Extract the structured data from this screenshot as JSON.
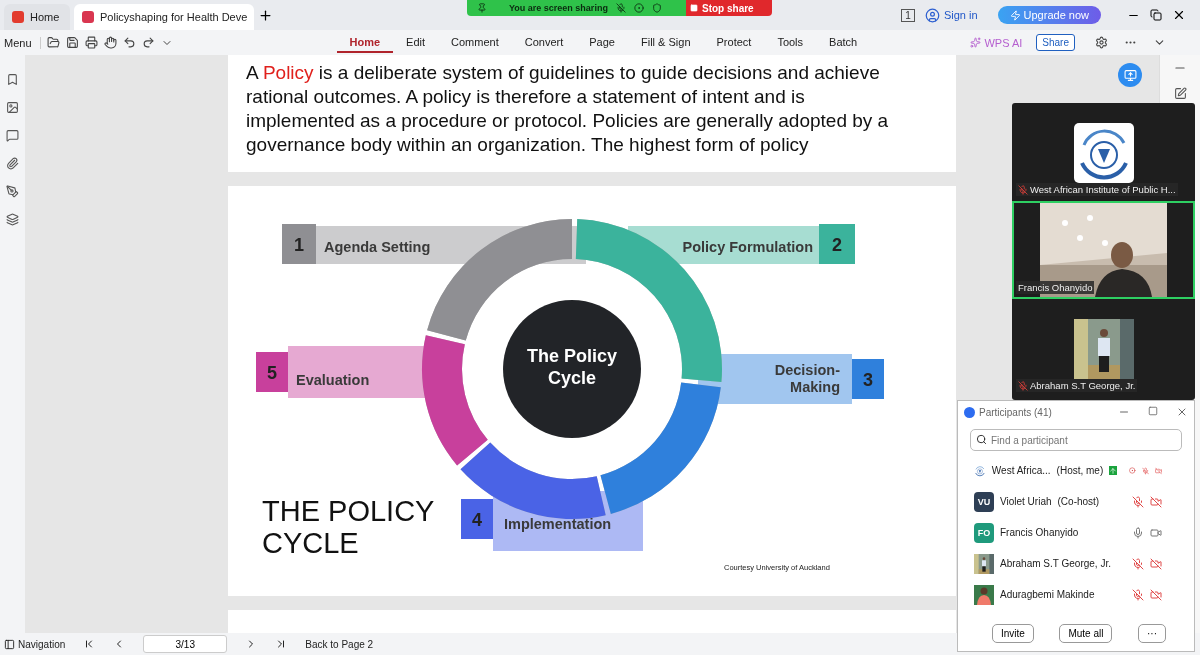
{
  "app_tabs": [
    {
      "label": "Home",
      "selected": false
    },
    {
      "label": "Policyshaping for Health Deve",
      "selected": true
    }
  ],
  "share_banner": {
    "message": "You are screen sharing",
    "stop": "Stop share"
  },
  "account": {
    "page_badge": "1",
    "sign_in": "Sign in",
    "upgrade": "Upgrade now"
  },
  "toolbar": {
    "menu": "Menu",
    "ribbon_tabs": [
      {
        "label": "Home",
        "selected": true
      },
      {
        "label": "Edit",
        "selected": false
      },
      {
        "label": "Comment",
        "selected": false
      },
      {
        "label": "Convert",
        "selected": false
      },
      {
        "label": "Page",
        "selected": false
      },
      {
        "label": "Fill & Sign",
        "selected": false
      },
      {
        "label": "Protect",
        "selected": false
      },
      {
        "label": "Tools",
        "selected": false
      },
      {
        "label": "Batch",
        "selected": false
      }
    ],
    "ai": "WPS AI",
    "share": "Share"
  },
  "document": {
    "paragraph": {
      "before": "A ",
      "term": "Policy",
      "after": " is a deliberate system of guidelines to guide decisions and achieve rational outcomes. A policy is therefore a statement of intent and is implemented as a procedure or protocol. Policies are generally adopted by a governance body within an organization. The highest form of policy"
    },
    "slide": {
      "center": [
        "The Policy",
        "Cycle"
      ],
      "title": [
        "THE POLICY",
        "CYCLE"
      ],
      "credit": "Courtesy University of Auckland",
      "steps": [
        {
          "number": "1",
          "lines": [
            "Agenda Setting"
          ],
          "color": "#8f8f93"
        },
        {
          "number": "2",
          "lines": [
            "Policy Formulation"
          ],
          "color": "#3bb39c"
        },
        {
          "number": "3",
          "lines": [
            "Decision-",
            "Making"
          ],
          "color": "#2f80dc"
        },
        {
          "number": "4",
          "lines": [
            "Implementation"
          ],
          "color": "#4a63e6"
        },
        {
          "number": "5",
          "lines": [
            "Evaluation"
          ],
          "color": "#c8409c"
        }
      ]
    }
  },
  "video_panel": {
    "tiles": [
      {
        "kind": "logo",
        "name": "West African Institute of Public H...",
        "muted": true,
        "speaking": false
      },
      {
        "kind": "video",
        "name": "Francis Ohanyido",
        "muted": false,
        "speaking": true
      },
      {
        "name": "Abraham S.T George, Jr.",
        "muted": true,
        "speaking": false
      }
    ]
  },
  "participants": {
    "title": "Participants (41)",
    "search": {
      "placeholder": "Find a participant"
    },
    "rows": [
      {
        "name": "West Africa...",
        "role": "(Host, me)",
        "kind": "logo",
        "sharing": true,
        "recording": true,
        "mic_muted": true,
        "video_off": true
      },
      {
        "name": "Violet Uriah",
        "role": "(Co-host)",
        "kind": "initials",
        "initials": "VU",
        "color": "#2e3f55",
        "sharing": false,
        "recording": false,
        "mic_muted": true,
        "video_off": true
      },
      {
        "name": "Francis Ohanyido",
        "kind": "initials",
        "initials": "FO",
        "color": "#1f9a7c",
        "sharing": false,
        "recording": false,
        "mic_muted": false,
        "video_off": false
      },
      {
        "name": "Abraham S.T George, Jr.",
        "sharing": false,
        "recording": false,
        "mic_muted": true,
        "video_off": true
      },
      {
        "name": "Aduragbemi Makinde",
        "sharing": false,
        "recording": false,
        "mic_muted": true,
        "video_off": true
      }
    ],
    "buttons": [
      "Invite",
      "Mute all",
      "···"
    ]
  },
  "status_bar": {
    "navigation": "Navigation",
    "page": "3/13",
    "back": "Back to Page 2"
  }
}
